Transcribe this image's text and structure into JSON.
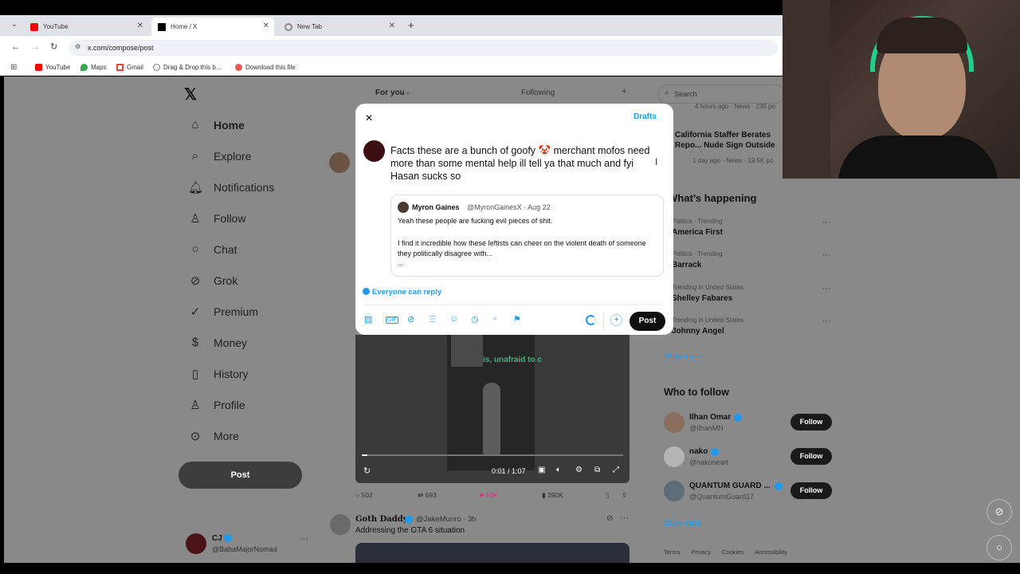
{
  "browser": {
    "tabs": [
      {
        "title": "YouTube"
      },
      {
        "title": "Home / X"
      },
      {
        "title": "New Tab"
      }
    ],
    "new_tab_label": "+",
    "url": "x.com/compose/post",
    "bookmarks": [
      "YouTube",
      "Maps",
      "Gmail",
      "Drag & Drop this b...",
      "Download this file"
    ]
  },
  "x": {
    "logo": "𝕏",
    "feed_tabs": {
      "for_you": "For you",
      "following": "Following"
    },
    "nav": [
      {
        "label": "Home",
        "icon": "home-icon"
      },
      {
        "label": "Explore",
        "icon": "search-icon"
      },
      {
        "label": "Notifications",
        "icon": "bell-icon"
      },
      {
        "label": "Follow",
        "icon": "person-plus-icon"
      },
      {
        "label": "Chat",
        "icon": "chat-icon"
      },
      {
        "label": "Grok",
        "icon": "grok-icon"
      },
      {
        "label": "Premium",
        "icon": "premium-icon"
      },
      {
        "label": "Money",
        "icon": "money-icon"
      },
      {
        "label": "History",
        "icon": "bookmark-icon"
      },
      {
        "label": "Profile",
        "icon": "person-icon"
      },
      {
        "label": "More",
        "icon": "more-circle-icon"
      }
    ],
    "post_button": "Post",
    "account": {
      "name": "CJ",
      "handle": "@BabaMajorNomad"
    },
    "search_placeholder": "Search",
    "right": {
      "top_meta": "4 hours ago · News · 230 po",
      "news_title": "California Staffer Berates Repo... Nude Sign Outside Capitol",
      "news_meta": "1 day ago · News · 19.5K po",
      "happening_heading": "What’s happening",
      "trends": [
        {
          "meta": "Politics · Trending",
          "title": "America First"
        },
        {
          "meta": "Politics · Trending",
          "title": "Barrack"
        },
        {
          "meta": "Trending in United States",
          "title": "Shelley Fabares"
        },
        {
          "meta": "Trending in United States",
          "title": "Johnny Angel"
        }
      ],
      "show_more": "Show more",
      "who_to_follow_heading": "Who to follow",
      "suggestions": [
        {
          "name": "Ilhan Omar",
          "handle": "@IlhanMN",
          "button": "Follow"
        },
        {
          "name": "nako",
          "handle": "@nakoneart",
          "button": "Follow"
        },
        {
          "name": "QUANTUM GUARD ...",
          "handle": "@QuantumGuard17",
          "button": "Follow"
        }
      ],
      "show_more_2": "Show more",
      "footer": [
        "Terms",
        "Privacy",
        "Cookies",
        "Accessibility"
      ]
    },
    "feed": {
      "video_caption": "is, unafraid to c",
      "video_time": "0:01 / 1:07",
      "stats": {
        "replies": "502",
        "reposts": "693",
        "likes": "10K",
        "views": "390K"
      },
      "next_post": {
        "name": "Goth Daddy",
        "handle": "@JakeMunro · 3h",
        "text": "Addressing the GTA 6 situation"
      }
    }
  },
  "compose": {
    "close_label": "✕",
    "drafts_label": "Drafts",
    "text": "Facts these are a bunch of goofy 🤡 merchant mofos need more than some mental help ill tell ya that much and fyi Hasan sucks so",
    "quote": {
      "name": "Myron Gaines",
      "handle": "@MyronGainesX · Aug 22",
      "line1": "Yeah these people are fucking evil pieces of shit.",
      "line2": "I find it incredible how these leftists can cheer on the violent death of someone they politically disagree with...",
      "ellipsis": "..."
    },
    "reply_setting": "Everyone can reply",
    "post_label": "Post",
    "tools": [
      "image-icon",
      "gif-icon",
      "grok-icon",
      "poll-icon",
      "emoji-icon",
      "schedule-icon",
      "location-icon",
      "flag-icon"
    ]
  },
  "colors": {
    "accent": "#1d9bf0",
    "like": "#f91880",
    "verified": "#1d9bf0"
  }
}
